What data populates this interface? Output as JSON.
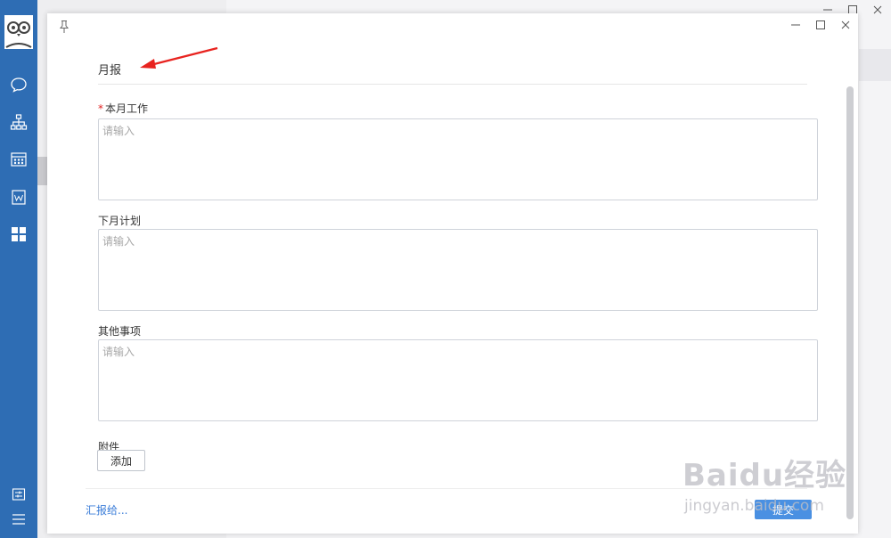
{
  "dialog": {
    "title": "月报",
    "fields": [
      {
        "label": "本月工作",
        "required": true,
        "required_mark": "*",
        "placeholder": "请输入",
        "value": ""
      },
      {
        "label": "下月计划",
        "required": false,
        "placeholder": "请输入",
        "value": ""
      },
      {
        "label": "其他事项",
        "required": false,
        "placeholder": "请输入",
        "value": ""
      }
    ],
    "attachment": {
      "label": "附件",
      "add_button": "添加"
    },
    "footer": {
      "report_to_link": "汇报给...",
      "submit_button": "提交"
    }
  },
  "watermark": {
    "logo": "Baidu经验",
    "url": "jingyan.baidu.com"
  },
  "sidebar": {
    "icons": [
      "avatar",
      "chat-icon",
      "org-chart-icon",
      "calendar-icon",
      "document-icon",
      "apps-grid-icon",
      "settings-icon",
      "menu-icon"
    ]
  },
  "colors": {
    "sidebar": "#2e6db4",
    "link": "#3b7dd8",
    "primary_button": "#4a90e2",
    "required_mark": "#e02020",
    "annotation_arrow": "#e8231f"
  }
}
